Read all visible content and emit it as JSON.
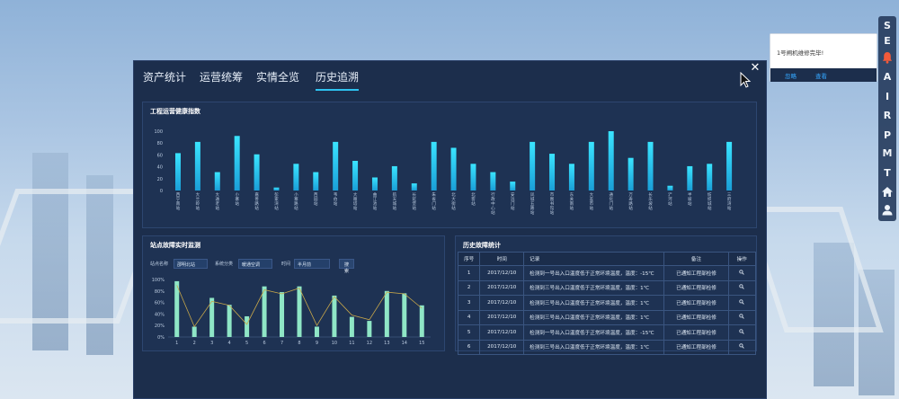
{
  "tabs": [
    {
      "label": "资产统计",
      "active": false
    },
    {
      "label": "运营统筹",
      "active": false
    },
    {
      "label": "实情全览",
      "active": false
    },
    {
      "label": "历史追溯",
      "active": true
    }
  ],
  "close_label": "✕",
  "health_panel": {
    "title": "工程运营健康指数",
    "chart_data": {
      "type": "bar",
      "title": "",
      "ylim": [
        0,
        100
      ],
      "yticks": [
        0,
        20,
        40,
        60,
        80,
        100
      ],
      "categories": [
        "西宁南站",
        "大兰岭站",
        "大通老站",
        "小寨站",
        "嘉善路站",
        "彭家湾站",
        "小寨路站",
        "西园站",
        "韦伯站",
        "大雁塔站",
        "曲江池站",
        "航天城站",
        "长延堡站",
        "朱雀门站",
        "北大街站",
        "北客站",
        "行政中心站",
        "安远门站",
        "凤城五路站",
        "市图书馆站",
        "东关南站",
        "大差市站",
        "通化门站",
        "万寿路站",
        "长乐坡站",
        "浐河站",
        "半坡站",
        "纺织城站",
        "三府湾站",
        "米家崖站",
        "胡家庙站",
        "康复路站"
      ],
      "values": [
        63,
        82,
        31,
        92,
        61,
        5,
        45,
        31,
        82,
        50,
        22,
        41,
        12,
        82,
        72,
        45,
        31,
        15,
        82,
        62,
        45,
        82,
        100,
        55,
        82,
        8,
        41,
        45,
        82
      ],
      "grid": false,
      "legend": "none"
    }
  },
  "fault_panel": {
    "title": "站点故障实时监测",
    "filters": {
      "site_label": "站点名称",
      "site_value": "邵明北站",
      "system_label": "系统分类",
      "system_value": "暖通空调",
      "time_label": "时间",
      "time_value": "半月前",
      "search_label": "搜索"
    },
    "chart_data": {
      "type": "bar",
      "title": "",
      "categories": [
        "1",
        "2",
        "3",
        "4",
        "5",
        "6",
        "7",
        "8",
        "9",
        "10",
        "11",
        "12",
        "13",
        "14",
        "15"
      ],
      "ylim": [
        0,
        100
      ],
      "yticks": [
        "0%",
        "20%",
        "40%",
        "60%",
        "80%",
        "100%"
      ],
      "values": [
        97,
        18,
        68,
        56,
        36,
        88,
        78,
        88,
        18,
        72,
        35,
        28,
        80,
        76,
        55
      ],
      "line_values": [
        90,
        18,
        62,
        55,
        22,
        82,
        75,
        85,
        20,
        70,
        38,
        30,
        78,
        75,
        50
      ],
      "grid": false,
      "legend": "none"
    }
  },
  "history_panel": {
    "title": "历史故障统计",
    "columns": [
      "序号",
      "时间",
      "记录",
      "备注",
      "操作"
    ],
    "rows": [
      {
        "id": "1",
        "time": "2017/12/10",
        "record": "检测到一号出入口温度低于正常环境温度，温度：-15℃",
        "note": "已通知工程部检修"
      },
      {
        "id": "2",
        "time": "2017/12/10",
        "record": "检测到三号出入口温度低于正常环境温度，温度：1℃",
        "note": "已通知工程部检修"
      },
      {
        "id": "3",
        "time": "2017/12/10",
        "record": "检测到三号出入口温度低于正常环境温度，温度：1℃",
        "note": "已通知工程部检修"
      },
      {
        "id": "4",
        "time": "2017/12/10",
        "record": "检测到三号出入口温度低于正常环境温度，温度：1℃",
        "note": "已通知工程部检修"
      },
      {
        "id": "5",
        "time": "2017/12/10",
        "record": "检测到一号出入口温度低于正常环境温度，温度：-15℃",
        "note": "已通知工程部检修"
      },
      {
        "id": "6",
        "time": "2017/12/10",
        "record": "检测到三号出入口温度低于正常环境温度，温度：1℃",
        "note": "已通知工程部检修"
      }
    ]
  },
  "notification": {
    "message": "1号闸机维修完毕!",
    "ignore_label": "忽略",
    "view_label": "查看"
  },
  "rail": {
    "items": [
      "S",
      "E",
      "A",
      "I",
      "R",
      "P",
      "M",
      "T"
    ],
    "icons": [
      "bell-icon",
      "home-icon",
      "user-icon"
    ]
  },
  "colors": {
    "bar_cyan": "#2fd6f6",
    "bar_mint": "#8fe6c6",
    "line": "#c9a84a",
    "panel_bg": "#1e3253",
    "bell": "#f25a3a"
  }
}
